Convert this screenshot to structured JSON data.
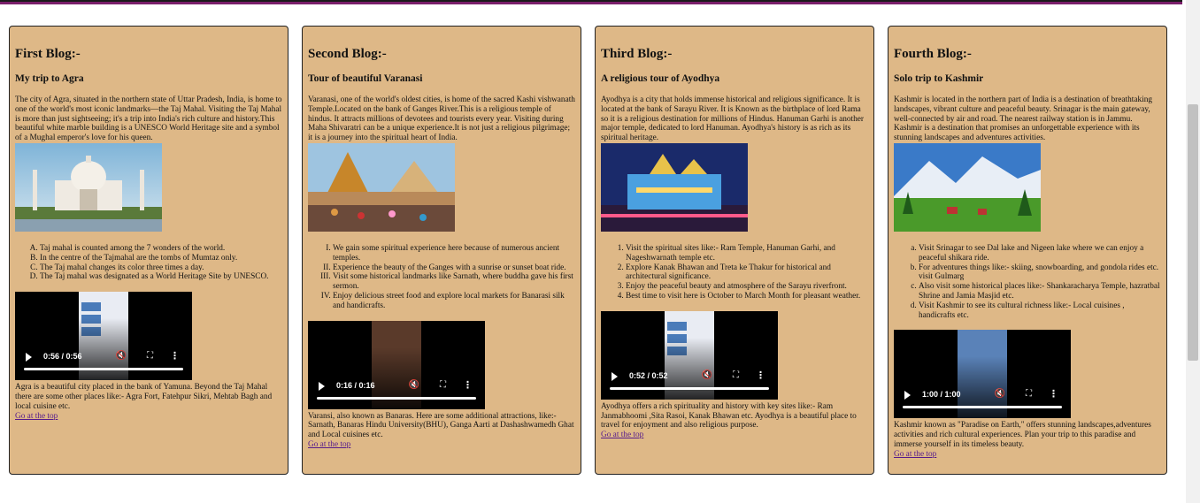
{
  "cards": [
    {
      "heading": "First Blog:-",
      "subheading": "My trip to Agra",
      "intro": "The city of Agra, situated in the northern state of Uttar Pradesh, India, is home to one of the world's most iconic landmarks—the Taj Mahal. Visiting the Taj Mahal is more than just sightseeing; it's a trip into India's rich culture and history.This beautiful white marble building is a UNESCO World Heritage site and a symbol of a Mughal emperor's love for his queen.",
      "list_type": "A",
      "list": [
        "Taj mahal is counted among the 7 wonders of the world.",
        "In the centre of the Tajmahal are the tombs of Mumtaz only.",
        "The Taj mahal changes its color three times a day.",
        "The Taj mahal was designated as a World Heritage Site by UNESCO."
      ],
      "video_time": "0:56 / 0:56",
      "outro": "Agra is a beautiful city placed in the bank of Yamuna. Beyond the Taj Mahal there are some other places like:- Agra Fort, Fatehpur Sikri, Mehtab Bagh and local cuisine etc.",
      "top_link": "Go at the top"
    },
    {
      "heading": "Second Blog:-",
      "subheading": "Tour of beautiful Varanasi",
      "intro": "Varanasi, one of the world's oldest cities, is home of the sacred Kashi vishwanath Temple.Located on the bank of Ganges River.This is a religious temple of hindus. It attracts millions of devotees and tourists every year. Visiting during Maha Shivaratri can be a unique experience.It is not just a religious pilgrimage; it is a journey into the spiritual heart of India.",
      "list_type": "I",
      "list": [
        "We gain some spiritual experience here because of numerous ancient temples.",
        "Experience the beauty of the Ganges with a sunrise or sunset boat ride.",
        "Visit some historical landmarks like Sarnath, where buddha gave his first sermon.",
        "Enjoy delicious street food and explore local markets for Banarasi silk and handicrafts."
      ],
      "video_time": "0:16 / 0:16",
      "outro": "Varansi, also known as Banaras. Here are some additional attractions, like:- Sarnath, Banaras Hindu University(BHU), Ganga Aarti at Dashashwamedh Ghat and Local cuisines etc.",
      "top_link": "Go at the top"
    },
    {
      "heading": "Third Blog:-",
      "subheading": "A religious tour of Ayodhya",
      "intro": "Ayodhya is a city that holds immense historical and religious significance. It is located at the bank of Sarayu River. It is Known as the birthplace of lord Rama so it is a religious destination for millions of Hindus. Hanuman Garhi is another major temple, dedicated to lord Hanuman. Ayodhya's history is as rich as its spiritual heritage.",
      "list_type": "1",
      "list": [
        "Visit the spiritual sites like:- Ram Temple, Hanuman Garhi, and Nageshwarnath temple etc.",
        "Explore Kanak Bhawan and Treta ke Thakur for historical and architectural significance.",
        "Enjoy the peaceful beauty and atmosphere of the Sarayu riverfront.",
        "Best time to visit here is October to March Month for pleasant weather."
      ],
      "video_time": "0:52 / 0:52",
      "outro": "Ayodhya offers a rich spirituality and history with key sites like:- Ram Janmabhoomi ,Sita Rasoi, Kanak Bhawan etc. Ayodhya is a beautiful place to travel for enjoyment and also religious purpose.",
      "top_link": "Go at the top"
    },
    {
      "heading": "Fourth Blog:-",
      "subheading": "Solo trip to Kashmir",
      "intro": "Kashmir is located in the northern part of India is a destination of breathtaking landscapes, vibrant culture and peaceful beauty. Srinagar is the main gateway, well-connected by air and road. The nearest railway station is in Jammu. Kashmir is a destination that promises an unforgettable experience with its stunning landscapes and adventures activities.",
      "list_type": "a",
      "list": [
        "Visit Srinagar to see Dal lake and Nigeen lake where we can enjoy a peaceful shikara ride.",
        "For adventures things like:- skiing, snowboarding, and gondola rides etc. visit Gulmarg",
        "Also visit some historical places like:- Shankaracharya Temple, hazratbal Shrine and Jamia Masjid etc.",
        "Visit Kashmir to see its cultural richness like:- Local cuisines , handicrafts etc."
      ],
      "video_time": "1:00 / 1:00",
      "outro": "Kashmir known as \"Paradise on Earth,\" offers stunning landscapes,adventures activities and rich cultural experiences. Plan your trip to this paradise and immerse yourself in its timeless beauty.",
      "top_link": "Go at the top"
    }
  ],
  "colors": {
    "card_bg": "#deb887",
    "link": "#551a8b",
    "accent_bar": "#7a1f6a"
  },
  "icons": {
    "play": "play-icon",
    "mute": "mute-icon",
    "fullscreen": "fullscreen-icon",
    "more": "more-options-icon"
  }
}
